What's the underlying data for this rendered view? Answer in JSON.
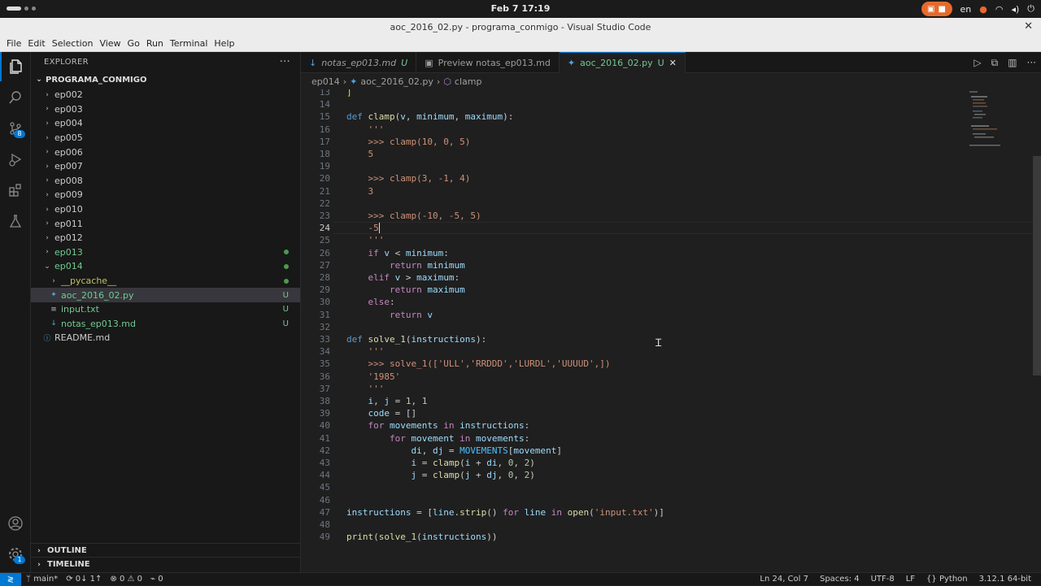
{
  "system": {
    "clock": "Feb 7  17:19",
    "lang": "en"
  },
  "window": {
    "title": "aoc_2016_02.py - programa_conmigo - Visual Studio Code",
    "close": "✕"
  },
  "menu": [
    "File",
    "Edit",
    "Selection",
    "View",
    "Go",
    "Run",
    "Terminal",
    "Help"
  ],
  "activity": {
    "scm_badge": "8",
    "settings_badge": "1"
  },
  "sidebar": {
    "title": "EXPLORER",
    "more": "···",
    "root": "PROGRAMA_CONMIGO",
    "items": [
      {
        "label": "ep002",
        "type": "folder",
        "depth": 1,
        "open": false,
        "status": ""
      },
      {
        "label": "ep003",
        "type": "folder",
        "depth": 1,
        "open": false,
        "status": ""
      },
      {
        "label": "ep004",
        "type": "folder",
        "depth": 1,
        "open": false,
        "status": ""
      },
      {
        "label": "ep005",
        "type": "folder",
        "depth": 1,
        "open": false,
        "status": ""
      },
      {
        "label": "ep006",
        "type": "folder",
        "depth": 1,
        "open": false,
        "status": ""
      },
      {
        "label": "ep007",
        "type": "folder",
        "depth": 1,
        "open": false,
        "status": ""
      },
      {
        "label": "ep008",
        "type": "folder",
        "depth": 1,
        "open": false,
        "status": ""
      },
      {
        "label": "ep009",
        "type": "folder",
        "depth": 1,
        "open": false,
        "status": ""
      },
      {
        "label": "ep010",
        "type": "folder",
        "depth": 1,
        "open": false,
        "status": ""
      },
      {
        "label": "ep011",
        "type": "folder",
        "depth": 1,
        "open": false,
        "status": ""
      },
      {
        "label": "ep012",
        "type": "folder",
        "depth": 1,
        "open": false,
        "status": ""
      },
      {
        "label": "ep013",
        "type": "folder",
        "depth": 1,
        "open": false,
        "status": "dot"
      },
      {
        "label": "ep014",
        "type": "folder",
        "depth": 1,
        "open": true,
        "status": "dot"
      },
      {
        "label": "__pycache__",
        "type": "folder",
        "depth": 2,
        "open": false,
        "status": "dot"
      },
      {
        "label": "aoc_2016_02.py",
        "type": "py",
        "depth": 2,
        "open": false,
        "status": "U",
        "selected": true
      },
      {
        "label": "input.txt",
        "type": "txt",
        "depth": 2,
        "open": false,
        "status": "U"
      },
      {
        "label": "notas_ep013.md",
        "type": "md",
        "depth": 2,
        "open": false,
        "status": "U"
      },
      {
        "label": "README.md",
        "type": "info",
        "depth": 1,
        "open": false,
        "status": ""
      }
    ],
    "outline": "OUTLINE",
    "timeline": "TIMELINE"
  },
  "tabs": [
    {
      "label": "notas_ep013.md",
      "suffix": "U",
      "icon": "↓",
      "active": false,
      "italic": true
    },
    {
      "label": "Preview notas_ep013.md",
      "suffix": "",
      "icon": "▣",
      "active": false,
      "italic": false
    },
    {
      "label": "aoc_2016_02.py",
      "suffix": "U",
      "icon": "✦",
      "active": true,
      "italic": false
    }
  ],
  "breadcrumb": [
    "ep014",
    "aoc_2016_02.py",
    "clamp"
  ],
  "editor": {
    "current_line": 24,
    "lines": [
      {
        "n": 13,
        "t": "]"
      },
      {
        "n": 14,
        "t": ""
      },
      {
        "n": 15,
        "t": "def clamp(v, minimum, maximum):"
      },
      {
        "n": 16,
        "t": "    '''"
      },
      {
        "n": 17,
        "t": "    >>> clamp(10, 0, 5)"
      },
      {
        "n": 18,
        "t": "    5"
      },
      {
        "n": 19,
        "t": ""
      },
      {
        "n": 20,
        "t": "    >>> clamp(3, -1, 4)"
      },
      {
        "n": 21,
        "t": "    3"
      },
      {
        "n": 22,
        "t": ""
      },
      {
        "n": 23,
        "t": "    >>> clamp(-10, -5, 5)"
      },
      {
        "n": 24,
        "t": "    -5"
      },
      {
        "n": 25,
        "t": "    '''"
      },
      {
        "n": 26,
        "t": "    if v < minimum:"
      },
      {
        "n": 27,
        "t": "        return minimum"
      },
      {
        "n": 28,
        "t": "    elif v > maximum:"
      },
      {
        "n": 29,
        "t": "        return maximum"
      },
      {
        "n": 30,
        "t": "    else:"
      },
      {
        "n": 31,
        "t": "        return v"
      },
      {
        "n": 32,
        "t": ""
      },
      {
        "n": 33,
        "t": "def solve_1(instructions):"
      },
      {
        "n": 34,
        "t": "    '''"
      },
      {
        "n": 35,
        "t": "    >>> solve_1(['ULL','RRDDD','LURDL','UUUUD',])"
      },
      {
        "n": 36,
        "t": "    '1985'"
      },
      {
        "n": 37,
        "t": "    '''"
      },
      {
        "n": 38,
        "t": "    i, j = 1, 1"
      },
      {
        "n": 39,
        "t": "    code = []"
      },
      {
        "n": 40,
        "t": "    for movements in instructions:"
      },
      {
        "n": 41,
        "t": "        for movement in movements:"
      },
      {
        "n": 42,
        "t": "            di, dj = MOVEMENTS[movement]"
      },
      {
        "n": 43,
        "t": "            i = clamp(i + di, 0, 2)"
      },
      {
        "n": 44,
        "t": "            j = clamp(j + dj, 0, 2)"
      },
      {
        "n": 45,
        "t": ""
      },
      {
        "n": 46,
        "t": ""
      },
      {
        "n": 47,
        "t": "instructions = [line.strip() for line in open('input.txt')]"
      },
      {
        "n": 48,
        "t": ""
      },
      {
        "n": 49,
        "t": "print(solve_1(instructions))"
      }
    ]
  },
  "status": {
    "branch": "main*",
    "sync": "0↓ 1↑",
    "problems": "⊗ 0 ⚠ 0",
    "ports": "⌁ 0",
    "position": "Ln 24, Col 7",
    "spaces": "Spaces: 4",
    "encoding": "UTF-8",
    "eol": "LF",
    "language": "Python",
    "interpreter": "3.12.1 64-bit"
  }
}
